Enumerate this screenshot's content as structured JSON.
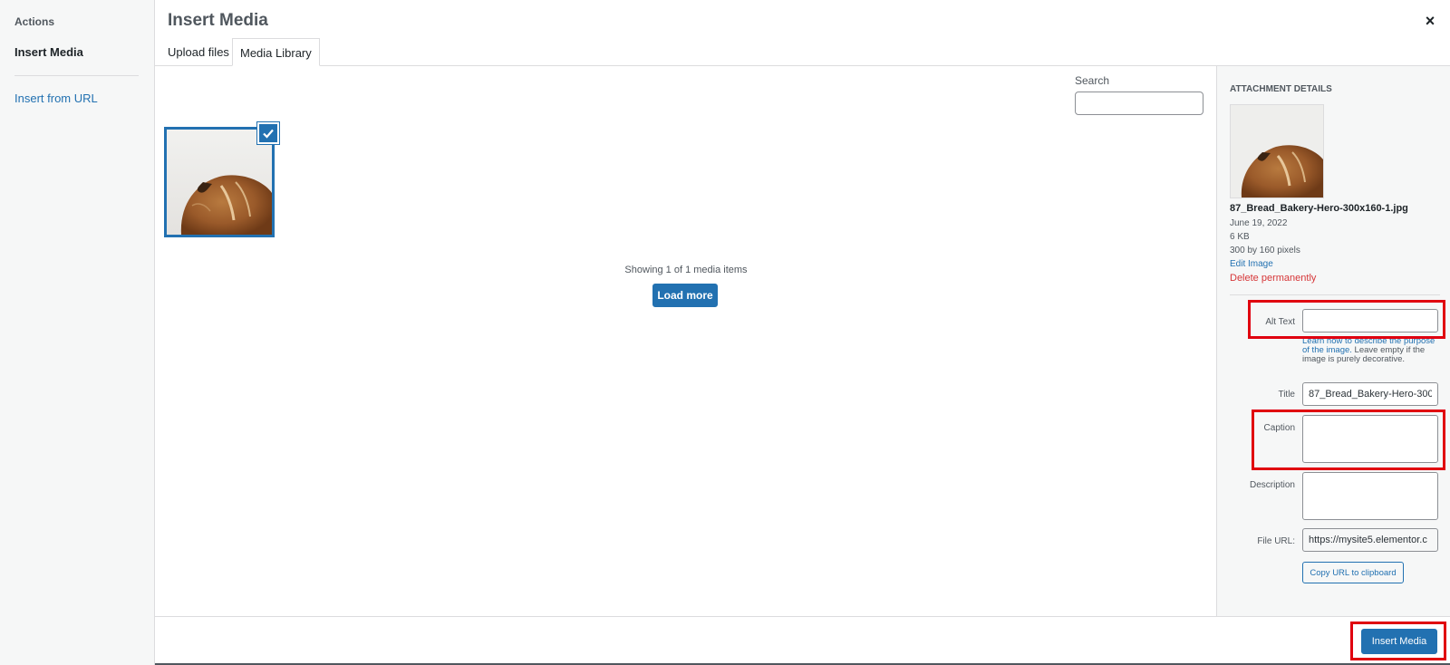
{
  "menu": {
    "heading": "Actions",
    "active_item": "Insert Media",
    "link_item": "Insert from URL"
  },
  "frame": {
    "title": "Insert Media",
    "close_glyph": "×"
  },
  "tabs": [
    {
      "label": "Upload files",
      "active": false
    },
    {
      "label": "Media Library",
      "active": true
    }
  ],
  "search": {
    "label": "Search",
    "value": ""
  },
  "library": {
    "showing_text": "Showing 1 of 1 media items",
    "load_more_label": "Load more"
  },
  "attachment": {
    "heading": "ATTACHMENT DETAILS",
    "filename": "87_Bread_Bakery-Hero-300x160-1.jpg",
    "date": "June 19, 2022",
    "size": "6 KB",
    "dimensions": "300 by 160 pixels",
    "edit_label": "Edit Image",
    "delete_label": "Delete permanently",
    "fields": {
      "alt_label": "Alt Text",
      "alt_value": "",
      "alt_help_link": "Learn how to describe the purpose of the image.",
      "alt_help_rest": " Leave empty if the image is purely decorative.",
      "title_label": "Title",
      "title_value": "87_Bread_Bakery-Hero-300",
      "caption_label": "Caption",
      "caption_value": "",
      "description_label": "Description",
      "description_value": "",
      "url_label": "File URL:",
      "url_value": "https://mysite5.elementor.c",
      "copy_label": "Copy URL to clipboard"
    }
  },
  "footer": {
    "insert_label": "Insert Media"
  },
  "colors": {
    "accent": "#2271b1",
    "danger": "#d63638",
    "highlight": "#e0000f",
    "sidebar_bg": "#f6f7f7"
  },
  "icons": {
    "close": "close-icon",
    "check": "checkmark-icon",
    "resize": "resize-handle-icon"
  }
}
